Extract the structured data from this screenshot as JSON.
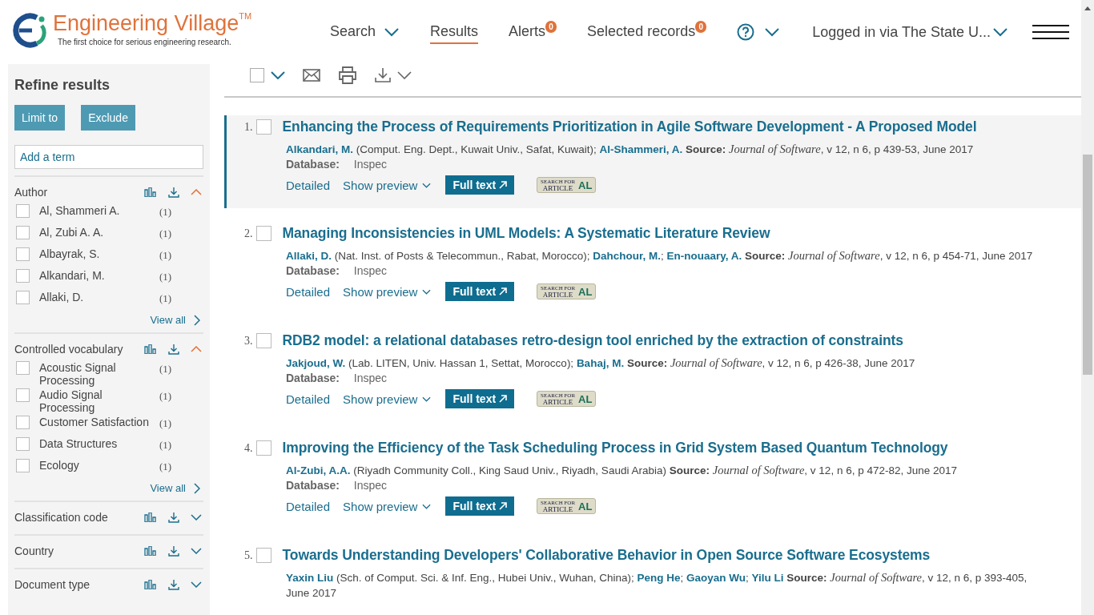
{
  "header": {
    "logo": {
      "title": "Engineering Village",
      "trademark": "TM",
      "tagline": "The first choice for serious engineering research."
    },
    "nav": [
      {
        "label": "Search",
        "kind": "menu",
        "selected": false
      },
      {
        "label": "Results",
        "kind": "link",
        "selected": true
      },
      {
        "label": "Alerts",
        "kind": "badge",
        "badge": "0",
        "selected": false
      },
      {
        "label": "Selected records",
        "kind": "badge",
        "badge": "0",
        "selected": false
      }
    ],
    "account": "Logged in via The State U..."
  },
  "toolbar": {
    "select_all_checked": false
  },
  "sidebar": {
    "title": "Refine results",
    "buttons": [
      "Limit to",
      "Exclude"
    ],
    "term": {
      "placeholder": "Add a term"
    },
    "facets": [
      {
        "title": "Author",
        "expanded": true,
        "view_all": "View all",
        "items": [
          {
            "label": "Al, Shammeri A.",
            "count": "(1)",
            "checked": false
          },
          {
            "label": "Al, Zubi A. A.",
            "count": "(1)",
            "checked": false
          },
          {
            "label": "Albayrak, S.",
            "count": "(1)",
            "checked": false
          },
          {
            "label": "Alkandari, M.",
            "count": "(1)",
            "checked": false
          },
          {
            "label": "Allaki, D.",
            "count": "(1)",
            "checked": false
          }
        ]
      },
      {
        "title": "Controlled vocabulary",
        "expanded": true,
        "view_all": "View all",
        "items": [
          {
            "label": "Acoustic Signal Processing",
            "count": "(1)",
            "checked": false
          },
          {
            "label": "Audio Signal Processing",
            "count": "(1)",
            "checked": false
          },
          {
            "label": "Customer Satisfaction",
            "count": "(1)",
            "checked": false
          },
          {
            "label": "Data Structures",
            "count": "(1)",
            "checked": false
          },
          {
            "label": "Ecology",
            "count": "(1)",
            "checked": false
          }
        ]
      },
      {
        "title": "Classification code",
        "expanded": false
      },
      {
        "title": "Country",
        "expanded": false
      },
      {
        "title": "Document type",
        "expanded": false
      }
    ]
  },
  "results": [
    {
      "number": "1.",
      "checked": false,
      "selected": true,
      "title": "Enhancing the Process of Requirements Prioritization in Agile Software Development - A Proposed Model",
      "citation": [
        {
          "kind": "author",
          "text": "Alkandari, M."
        },
        {
          "kind": "plain",
          "text": " (Comput. Eng. Dept., Kuwait Univ., Safat, Kuwait); "
        },
        {
          "kind": "author",
          "text": "Al-Shammeri, A."
        },
        {
          "kind": "label",
          "text": " Source: "
        },
        {
          "kind": "journal",
          "text": "Journal of Software"
        },
        {
          "kind": "plain",
          "text": ", v 12, n 6, p 439-53, June 2017"
        }
      ],
      "database_label": "Database:",
      "database": "Inspec",
      "actions": {
        "detailed": "Detailed",
        "preview": "Show preview",
        "full_text": "Full text",
        "article": [
          "SEARCH FOR",
          "ARTICLE",
          "AL"
        ]
      }
    },
    {
      "number": "2.",
      "checked": false,
      "selected": false,
      "title": "Managing Inconsistencies in UML Models: A Systematic Literature Review",
      "citation": [
        {
          "kind": "author",
          "text": "Allaki, D."
        },
        {
          "kind": "plain",
          "text": " (Nat. Inst. of Posts & Telecommun., Rabat, Morocco); "
        },
        {
          "kind": "author",
          "text": "Dahchour, M."
        },
        {
          "kind": "plain",
          "text": "; "
        },
        {
          "kind": "author",
          "text": "En-nouaary, A."
        },
        {
          "kind": "label",
          "text": " Source: "
        },
        {
          "kind": "journal",
          "text": "Journal of Software"
        },
        {
          "kind": "plain",
          "text": ", v 12, n 6, p 454-71, June 2017"
        }
      ],
      "database_label": "Database:",
      "database": "Inspec",
      "actions": {
        "detailed": "Detailed",
        "preview": "Show preview",
        "full_text": "Full text",
        "article": [
          "SEARCH FOR",
          "ARTICLE",
          "AL"
        ]
      }
    },
    {
      "number": "3.",
      "checked": false,
      "selected": false,
      "title": "RDB2 model: a relational databases retro-design tool enriched by the extraction of constraints",
      "citation": [
        {
          "kind": "author",
          "text": "Jakjoud, W."
        },
        {
          "kind": "plain",
          "text": " (Lab. LITEN, Univ. Hassan 1, Settat, Morocco); "
        },
        {
          "kind": "author",
          "text": "Bahaj, M."
        },
        {
          "kind": "label",
          "text": " Source: "
        },
        {
          "kind": "journal",
          "text": "Journal of Software"
        },
        {
          "kind": "plain",
          "text": ", v 12, n 6, p 426-38, June 2017"
        }
      ],
      "database_label": "Database:",
      "database": "Inspec",
      "actions": {
        "detailed": "Detailed",
        "preview": "Show preview",
        "full_text": "Full text",
        "article": [
          "SEARCH FOR",
          "ARTICLE",
          "AL"
        ]
      }
    },
    {
      "number": "4.",
      "checked": false,
      "selected": false,
      "title": "Improving the Efficiency of the Task Scheduling Process in Grid System Based Quantum Technology",
      "citation": [
        {
          "kind": "author",
          "text": "Al-Zubi, A.A."
        },
        {
          "kind": "plain",
          "text": " (Riyadh Community Coll., King Saud Univ., Riyadh, Saudi Arabia)"
        },
        {
          "kind": "label",
          "text": " Source: "
        },
        {
          "kind": "journal",
          "text": "Journal of Software"
        },
        {
          "kind": "plain",
          "text": ", v 12, n 6, p 472-82, June 2017"
        }
      ],
      "database_label": "Database:",
      "database": "Inspec",
      "actions": {
        "detailed": "Detailed",
        "preview": "Show preview",
        "full_text": "Full text",
        "article": [
          "SEARCH FOR",
          "ARTICLE",
          "AL"
        ]
      }
    },
    {
      "number": "5.",
      "checked": false,
      "selected": false,
      "title": "Towards Understanding Developers' Collaborative Behavior in Open Source Software Ecosystems",
      "citation": [
        {
          "kind": "author",
          "text": "Yaxin Liu"
        },
        {
          "kind": "plain",
          "text": " (Sch. of Comput. Sci. & Inf. Eng., Hubei Univ., Wuhan, China); "
        },
        {
          "kind": "author",
          "text": "Peng He"
        },
        {
          "kind": "plain",
          "text": "; "
        },
        {
          "kind": "author",
          "text": "Gaoyan Wu"
        },
        {
          "kind": "plain",
          "text": "; "
        },
        {
          "kind": "author",
          "text": "Yilu Li"
        },
        {
          "kind": "label",
          "text": " Source: "
        },
        {
          "kind": "journal",
          "text": "Journal of Software"
        },
        {
          "kind": "plain",
          "text": ", v 12, n 6, p 393-405, June 2017"
        }
      ]
    }
  ]
}
